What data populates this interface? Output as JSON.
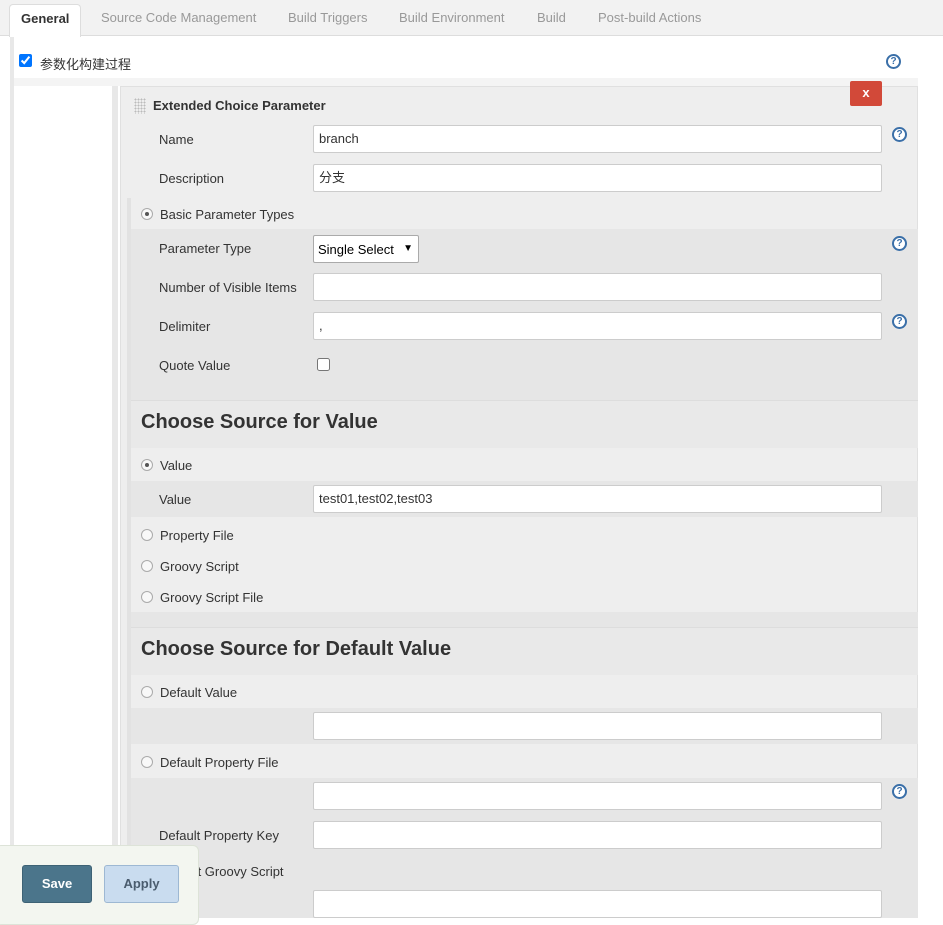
{
  "tabs": [
    "General",
    "Source Code Management",
    "Build Triggers",
    "Build Environment",
    "Build",
    "Post-build Actions"
  ],
  "parameterized_label": "参数化构建过程",
  "param": {
    "title": "Extended Choice Parameter",
    "delete_label": "x",
    "name_label": "Name",
    "name_value": "branch",
    "description_label": "Description",
    "description_value": "分支",
    "basic_types_label": "Basic Parameter Types",
    "param_type_label": "Parameter Type",
    "param_type_value": "Single Select",
    "visible_items_label": "Number of Visible Items",
    "visible_items_value": "",
    "delimiter_label": "Delimiter",
    "delimiter_value": ",",
    "quote_label": "Quote Value"
  },
  "source": {
    "heading": "Choose Source for Value",
    "value_radio": "Value",
    "value_label": "Value",
    "value_value": "test01,test02,test03",
    "property_file": "Property File",
    "groovy_script": "Groovy Script",
    "groovy_script_file": "Groovy Script File"
  },
  "default": {
    "heading": "Choose Source for Default Value",
    "default_value": "Default Value",
    "default_property_file": "Default Property File",
    "default_property_key": "Default Property Key",
    "default_groovy_script": "Default Groovy Script"
  },
  "buttons": {
    "save": "Save",
    "apply": "Apply"
  },
  "colors": {
    "save": "#4b758b",
    "apply": "#c9dcef",
    "delete": "#d24939",
    "help": "#3a6fa8"
  }
}
